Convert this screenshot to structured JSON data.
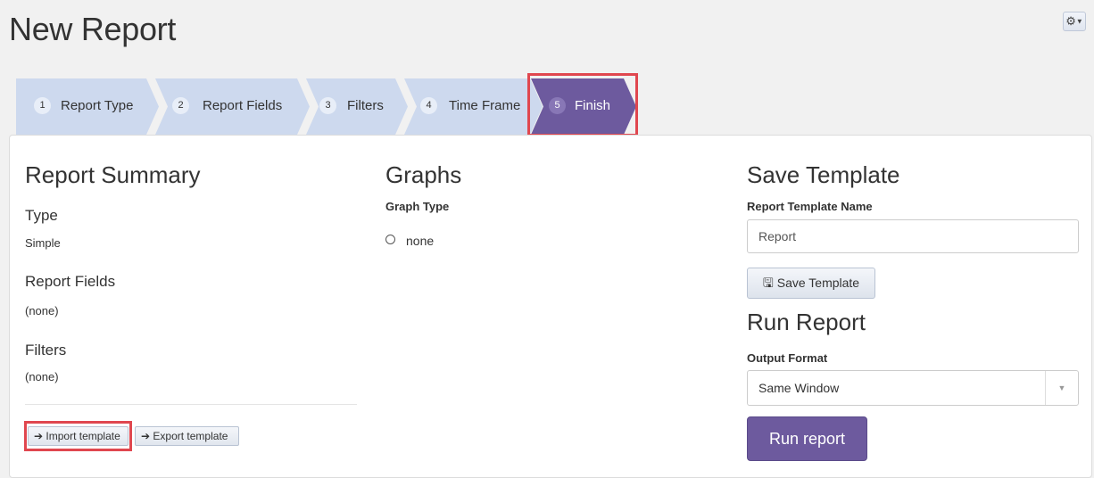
{
  "page": {
    "title": "New Report"
  },
  "header": {
    "settings_icon": "gear-icon"
  },
  "wizard": {
    "steps": [
      {
        "num": "1",
        "label": "Report Type",
        "active": false
      },
      {
        "num": "2",
        "label": "Report Fields",
        "active": false
      },
      {
        "num": "3",
        "label": "Filters",
        "active": false
      },
      {
        "num": "4",
        "label": "Time Frame",
        "active": false
      },
      {
        "num": "5",
        "label": "Finish",
        "active": true
      }
    ]
  },
  "summary": {
    "title": "Report Summary",
    "type_heading": "Type",
    "type_value": "Simple",
    "fields_heading": "Report Fields",
    "fields_value": "(none)",
    "filters_heading": "Filters",
    "filters_value": "(none)",
    "import_label": "Import template",
    "export_label": "Export template"
  },
  "graphs": {
    "title": "Graphs",
    "type_label": "Graph Type",
    "option_none": "none"
  },
  "save_template": {
    "title": "Save Template",
    "name_label": "Report Template Name",
    "name_value": "Report",
    "button_label": "Save Template"
  },
  "run_report": {
    "title": "Run Report",
    "format_label": "Output Format",
    "format_value": "Same Window",
    "button_label": "Run report"
  },
  "colors": {
    "accent": "#6d5a9e",
    "step_inactive": "#cdd9ee",
    "highlight": "#e0474f"
  }
}
